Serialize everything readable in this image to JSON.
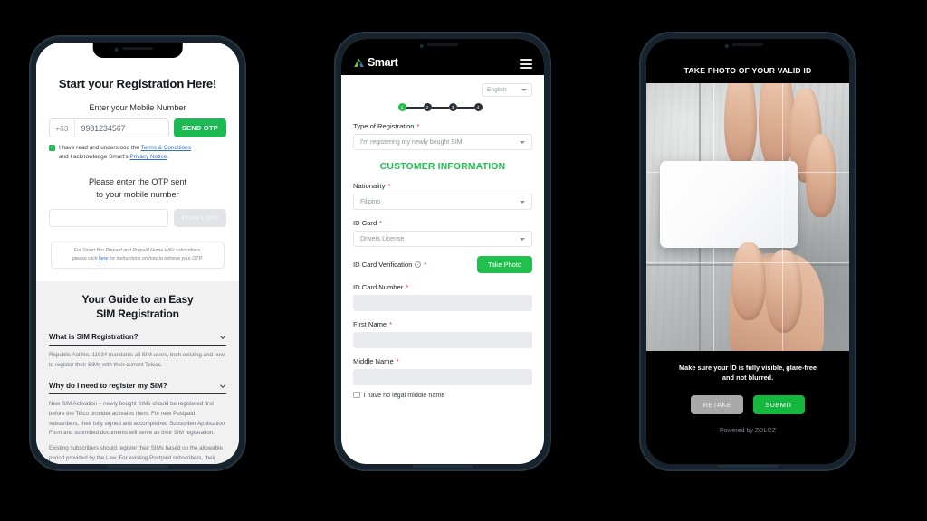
{
  "phone1": {
    "title": "Start your Registration Here!",
    "mobile_label": "Enter your Mobile Number",
    "country_code": "+63",
    "mobile_value": "9981234567",
    "mobile_placeholder": "9981234567",
    "send_otp_label": "SEND OTP",
    "consent_pre": "I have read and understood the",
    "consent_link1": "Terms & Conditions",
    "consent_mid": "and I acknowledge Smart's",
    "consent_link2": "Privacy Notice",
    "consent_end": ".",
    "otp_head_1": "Please enter the OTP sent",
    "otp_head_2": "to your mobile number",
    "otp_value": "",
    "verify_label": "VERIFY OTP",
    "note_1": "For Smart Bro Prepaid and Prepaid Home WiFi subscribers,",
    "note_2_pre": "please click",
    "note_2_link": "here",
    "note_2_post": "for instructions on how to retrieve your OTP.",
    "guide_title_1": "Your Guide to an Easy",
    "guide_title_2": "SIM Registration",
    "faq": [
      {
        "question": "What is SIM Registration?",
        "answer": "Republic Act No. 11934 mandates all SIM users, both existing and new, to register their SIMs with their current Telcos."
      },
      {
        "question": "Why do I need to register my SIM?",
        "answer_1": "New SIM Activation – newly bought SIMs should be registered first before the Telco provider activates them. For new Postpaid subscribers, their fully signed and accomplished Subscriber Application Form and submitted documents will serve as their SIM registration.",
        "answer_2": "Existing subscribers should register their SIMs based on the allowable period provided by the Law. For existing Postpaid subscribers, their previously submitted documents and fully"
      }
    ]
  },
  "phone2": {
    "brand": "Smart",
    "language": "English",
    "steps": [
      "1",
      "2",
      "3",
      "4"
    ],
    "active_step": 1,
    "type_label": "Type of Registration",
    "type_value": "I'm registering my newly bought SIM",
    "section_title": "CUSTOMER INFORMATION",
    "nationality_label": "Nationality",
    "nationality_value": "Filipino",
    "idcard_label": "ID Card",
    "idcard_value": "Drivers License",
    "verification_label": "ID Card Verification",
    "take_photo_label": "Take Photo",
    "idnumber_label": "ID Card Number",
    "idnumber_value": "",
    "firstname_label": "First Name",
    "firstname_value": "",
    "middlename_label": "Middle Name",
    "middlename_value": "",
    "no_middle_label": "I have no legal middle name"
  },
  "phone3": {
    "title": "TAKE PHOTO OF YOUR VALID ID",
    "note_1": "Make sure your ID is fully visible, glare-free",
    "note_2": "and not blurred.",
    "retake_label": "RETAKE",
    "submit_label": "SUBMIT",
    "footer": "Powered by ZOLOZ"
  },
  "colors": {
    "brand_green": "#22c14e",
    "send_otp_green": "#1db954",
    "submit_green": "#14b83e",
    "link_blue": "#2f6fd0",
    "required_red": "#e02b2b",
    "background": "#000000"
  }
}
